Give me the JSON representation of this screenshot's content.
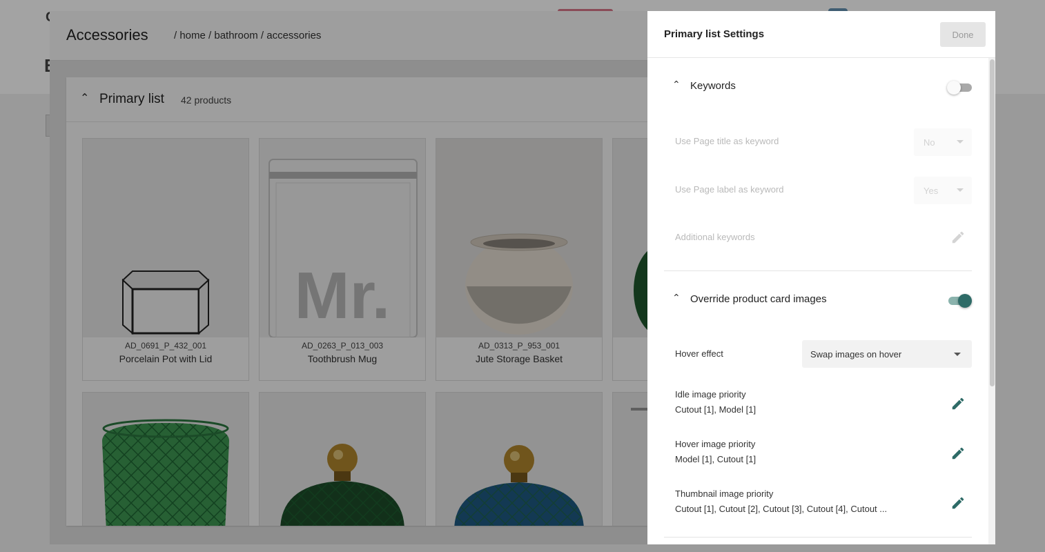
{
  "background": {
    "partial_letter_top": "C",
    "partial_letter_heading": "B"
  },
  "modal": {
    "title": "Accessories",
    "breadcrumb": "/ home / bathroom / accessories",
    "list": {
      "title": "Primary list",
      "count": "42 products",
      "products": [
        {
          "sku": "AD_0691_P_432_001",
          "name": "Porcelain Pot with Lid"
        },
        {
          "sku": "AD_0263_P_013_003",
          "name": "Toothbrush Mug",
          "print": "Mr."
        },
        {
          "sku": "AD_0313_P_953_001",
          "name": "Jute Storage Basket"
        }
      ]
    }
  },
  "panel": {
    "title": "Primary list Settings",
    "done_label": "Done",
    "keywords": {
      "title": "Keywords",
      "enabled": false,
      "rows": {
        "page_title_label": "Use Page title as keyword",
        "page_title_value": "No",
        "page_label_label": "Use Page label as keyword",
        "page_label_value": "Yes",
        "additional_label": "Additional keywords"
      }
    },
    "override": {
      "title": "Override product card images",
      "enabled": true,
      "hover_effect_label": "Hover effect",
      "hover_effect_value": "Swap images on hover",
      "idle_label": "Idle image priority",
      "idle_value": "Cutout [1], Model [1]",
      "hover_label": "Hover image priority",
      "hover_value": "Model [1], Cutout [1]",
      "thumb_label": "Thumbnail image priority",
      "thumb_value": "Cutout [1], Cutout [2], Cutout [3], Cutout [4], Cutout ..."
    }
  },
  "colors": {
    "accent": "#2e6b67",
    "toggle_on_track": "#8bb3ad"
  }
}
